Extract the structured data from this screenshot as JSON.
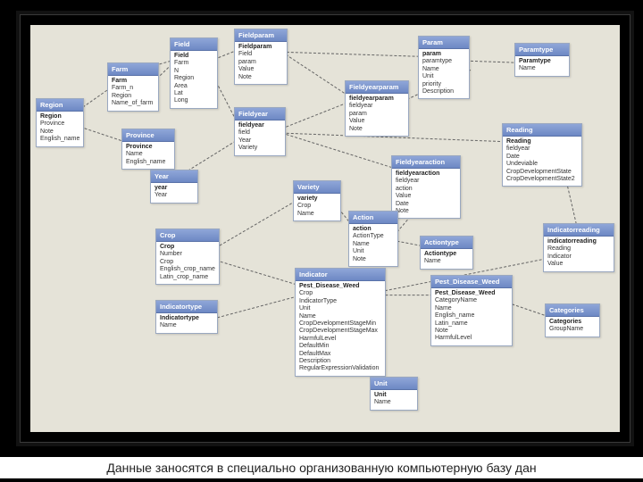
{
  "caption": "Данные заносятся в специально организованную компьютерную базу дан",
  "tables": {
    "region": {
      "title": "Region",
      "fields": [
        "Region",
        "Province",
        "Note",
        "English_name"
      ]
    },
    "farm": {
      "title": "Farm",
      "fields": [
        "Farm",
        "Farm_n",
        "Region",
        "Name_of_farm"
      ]
    },
    "province": {
      "title": "Province",
      "fields": [
        "Province",
        "Name",
        "English_name"
      ]
    },
    "field": {
      "title": "Field",
      "fields": [
        "Field",
        "Farm",
        "N",
        "Region",
        "Area",
        "Lat",
        "Long"
      ]
    },
    "fieldparam": {
      "title": "Fieldparam",
      "fields": [
        "Fieldparam",
        "Field",
        "param",
        "Value",
        "Note"
      ]
    },
    "fieldyear": {
      "title": "Fieldyear",
      "fields": [
        "fieldyear",
        "field",
        "Year",
        "Variety"
      ]
    },
    "fieldyearparam": {
      "title": "Fieldyearparam",
      "fields": [
        "fieldyearparam",
        "fieldyear",
        "param",
        "Value",
        "Note"
      ]
    },
    "param": {
      "title": "Param",
      "fields": [
        "param",
        "paramtype",
        "Name",
        "Unit",
        "priority",
        "Description"
      ]
    },
    "paramtype": {
      "title": "Paramtype",
      "fields": [
        "Paramtype",
        "Name"
      ]
    },
    "year": {
      "title": "Year",
      "fields": [
        "year",
        "Year"
      ]
    },
    "crop": {
      "title": "Crop",
      "fields": [
        "Crop",
        "Number",
        "Crop",
        "English_crop_name",
        "Latin_crop_name"
      ]
    },
    "variety": {
      "title": "Variety",
      "fields": [
        "variety",
        "Crop",
        "Name"
      ]
    },
    "indicatortype": {
      "title": "Indicatortype",
      "fields": [
        "Indicatortype",
        "Name"
      ]
    },
    "indicator": {
      "title": "Indicator",
      "fields": [
        "Pest_Disease_Weed",
        "Crop",
        "IndicatorType",
        "Unit",
        "Name",
        "CropDevelopmentStageMin",
        "CropDevelopmentStageMax",
        "HarmfulLevel",
        "DefaultMin",
        "DefaultMax",
        "Description",
        "RegularExpressionValidation"
      ]
    },
    "fieldyearaction": {
      "title": "Fieldyearaction",
      "fields": [
        "fieldyearaction",
        "fieldyear",
        "action",
        "Value",
        "Date",
        "Note"
      ]
    },
    "action": {
      "title": "Action",
      "fields": [
        "action",
        "ActionType",
        "Name",
        "Unit",
        "Note"
      ]
    },
    "actiontype": {
      "title": "Actiontype",
      "fields": [
        "Actiontype",
        "Name"
      ]
    },
    "reading": {
      "title": "Reading",
      "fields": [
        "Reading",
        "fieldyear",
        "Date",
        "Undeviable",
        "CropDevelopmentState",
        "CropDevelopmentState2"
      ]
    },
    "indicatorreading": {
      "title": "Indicatorreading",
      "fields": [
        "indicatorreading",
        "Reading",
        "Indicator",
        "Value"
      ]
    },
    "pdw": {
      "title": "Pest_Disease_Weed",
      "fields": [
        "Pest_Disease_Weed",
        "CategoryName",
        "Name",
        "English_name",
        "Latin_name",
        "Note",
        "HarmfulLevel"
      ]
    },
    "categories": {
      "title": "Categories",
      "fields": [
        "Categories",
        "GroupName"
      ]
    },
    "unit": {
      "title": "Unit",
      "fields": [
        "Unit",
        "Name"
      ]
    }
  }
}
